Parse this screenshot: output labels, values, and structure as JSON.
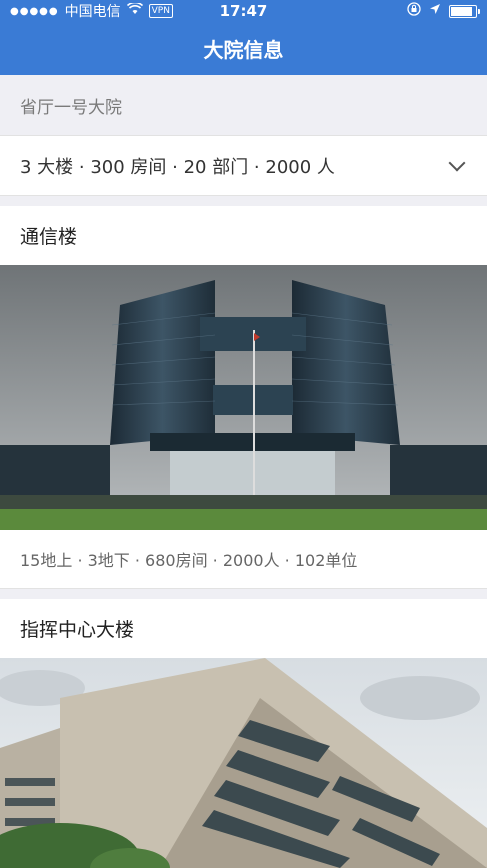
{
  "status_bar": {
    "carrier": "中国电信",
    "vpn": "VPN",
    "time": "17:47",
    "icons": [
      "signal-icon",
      "wifi-icon",
      "vpn-icon",
      "lock-rotation-icon",
      "location-icon",
      "battery-icon"
    ]
  },
  "nav": {
    "title": "大院信息"
  },
  "compound": {
    "name": "省厅一号大院",
    "summary": "3 大楼 · 300 房间 · 20 部门 · 2000 人"
  },
  "buildings": [
    {
      "name": "通信楼",
      "stats": "15地上 · 3地下 · 680房间 · 2000人 · 102单位"
    },
    {
      "name": "指挥中心大楼"
    }
  ],
  "colors": {
    "accent": "#3a7bd5",
    "background": "#efeff4"
  }
}
